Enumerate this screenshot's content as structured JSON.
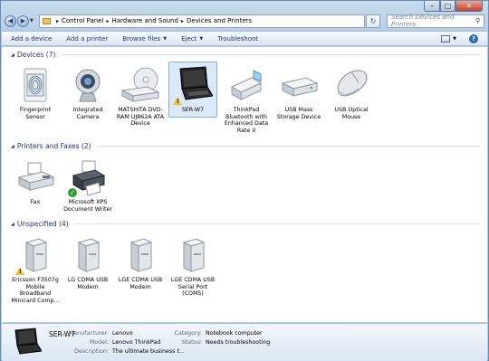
{
  "window": {
    "caption_buttons": {
      "minimize": "–",
      "maximize": "□",
      "close": "✕"
    }
  },
  "address": {
    "breadcrumbs": [
      "Control Panel",
      "Hardware and Sound",
      "Devices and Printers"
    ],
    "search_placeholder": "Search Devices and Printers"
  },
  "toolbar": {
    "add_device": "Add a device",
    "add_printer": "Add a printer",
    "browse_files": "Browse files",
    "eject": "Eject",
    "troubleshoot": "Troubleshoot"
  },
  "groups": {
    "devices": {
      "header": "Devices (7)",
      "items": [
        {
          "label": "Fingerprint Sensor",
          "icon": "fingerprint-sensor-icon"
        },
        {
          "label": "Integrated Camera",
          "icon": "webcam-icon"
        },
        {
          "label": "MATSHITA DVD-RAM UJ862A ATA Device",
          "icon": "dvd-drive-icon"
        },
        {
          "label": "SER-W7",
          "icon": "laptop-icon"
        },
        {
          "label": "ThinkPad Bluetooth with Enhanced Data Rate II",
          "icon": "bluetooth-adapter-icon"
        },
        {
          "label": "USB Mass Storage Device",
          "icon": "external-drive-icon"
        },
        {
          "label": "USB Optical Mouse",
          "icon": "mouse-icon"
        }
      ]
    },
    "printers": {
      "header": "Printers and Faxes (2)",
      "items": [
        {
          "label": "Fax",
          "icon": "fax-icon"
        },
        {
          "label": "Microsoft XPS Document Writer",
          "icon": "printer-icon"
        }
      ]
    },
    "unspecified": {
      "header": "Unspecified (4)",
      "items": [
        {
          "label": "Ericsson F3507g Mobile Broadband Minicard Comp...",
          "icon": "generic-device-icon"
        },
        {
          "label": "LG CDMA USB Modem",
          "icon": "generic-device-icon"
        },
        {
          "label": "LGE CDMA USB Modem",
          "icon": "generic-device-icon"
        },
        {
          "label": "LGE CDMA USB Serial Port (COM5)",
          "icon": "generic-device-icon"
        }
      ]
    }
  },
  "details": {
    "name": "SER-W7",
    "manufacturer_label": "Manufacturer:",
    "manufacturer": "Lenovo",
    "model_label": "Model:",
    "model": "Lenovo ThinkPad",
    "description_label": "Description:",
    "description": "The ultimate business t...",
    "category_label": "Category:",
    "category": "Notebook computer",
    "status_label": "Status:",
    "status": "Needs troubleshooting"
  },
  "colors": {
    "group_header": "#1e3287",
    "selection_bg": "#dbeaf9",
    "selection_border": "#84acdd"
  }
}
